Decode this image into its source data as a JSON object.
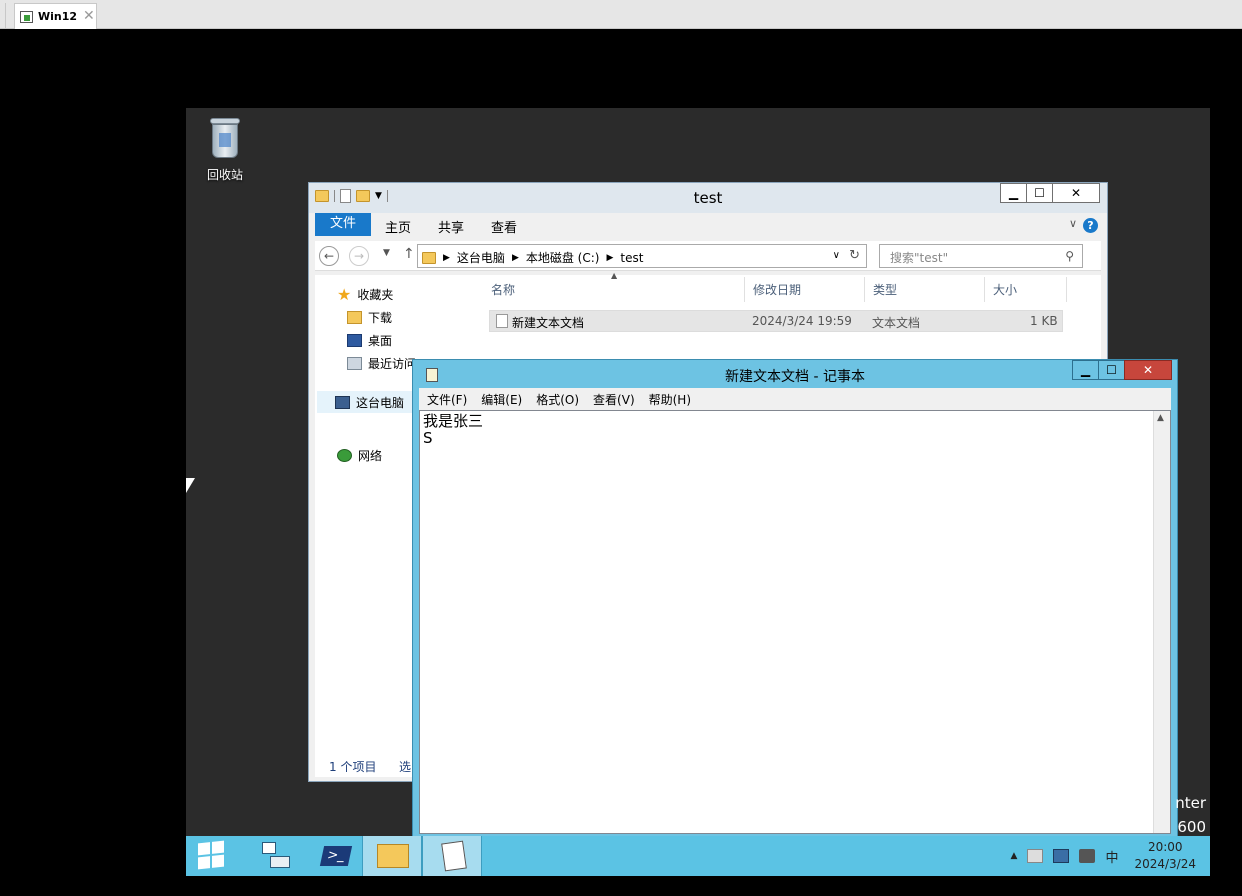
{
  "host": {
    "tab_title": "Win12",
    "tab_close": "✕"
  },
  "desktop": {
    "recycle_bin_label": "回收站",
    "bg_text_1": "nter",
    "bg_text_2": "600"
  },
  "explorer": {
    "title": "test",
    "min": "▁",
    "max": "☐",
    "close": "✕",
    "ribbon": {
      "file": "文件",
      "home": "主页",
      "share": "共享",
      "view": "查看",
      "help": "?"
    },
    "nav": {
      "back": "←",
      "forward": "→",
      "up": "↑",
      "breadcrumbs": [
        "这台电脑",
        "本地磁盘 (C:)",
        "test"
      ],
      "search_placeholder": "搜索\"test\""
    },
    "tree": {
      "favorites": "收藏夹",
      "downloads": "下载",
      "desktop": "桌面",
      "recent": "最近访问",
      "this_pc": "这台电脑",
      "network": "网络"
    },
    "columns": {
      "name": "名称",
      "modified": "修改日期",
      "type": "类型",
      "size": "大小"
    },
    "files": [
      {
        "name": "新建文本文档",
        "modified": "2024/3/24 19:59",
        "type": "文本文档",
        "size": "1 KB"
      }
    ],
    "status": {
      "count": "1 个项目",
      "selected": "选"
    }
  },
  "notepad": {
    "title": "新建文本文档 - 记事本",
    "min": "▁",
    "max": "☐",
    "close": "✕",
    "menu": [
      "文件(F)",
      "编辑(E)",
      "格式(O)",
      "查看(V)",
      "帮助(H)"
    ],
    "content": "我是张三\nS"
  },
  "taskbar": {
    "ime": "中",
    "time": "20:00",
    "date": "2024/3/24"
  }
}
